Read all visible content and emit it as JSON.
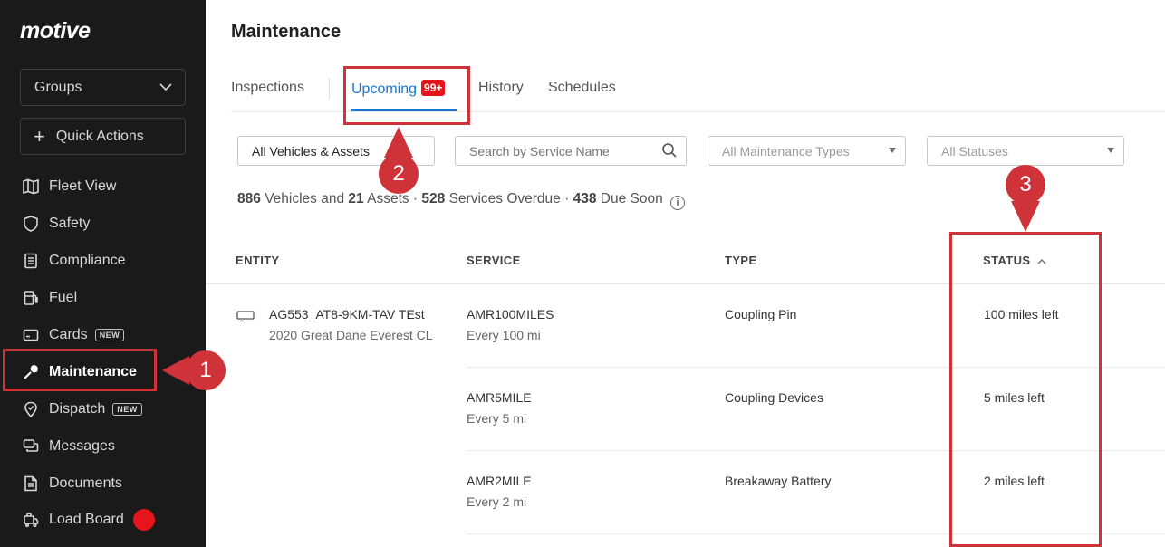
{
  "app": {
    "brand": "motive"
  },
  "sidebar": {
    "groups_label": "Groups",
    "quick_actions_label": "Quick Actions",
    "items": [
      {
        "label": "Fleet View",
        "icon": "map-icon",
        "badge": ""
      },
      {
        "label": "Safety",
        "icon": "shield-icon",
        "badge": ""
      },
      {
        "label": "Compliance",
        "icon": "document-list-icon",
        "badge": ""
      },
      {
        "label": "Fuel",
        "icon": "fuel-pump-icon",
        "badge": ""
      },
      {
        "label": "Cards",
        "icon": "card-icon",
        "badge": "NEW"
      },
      {
        "label": "Maintenance",
        "icon": "wrench-icon",
        "badge": "",
        "active": true
      },
      {
        "label": "Dispatch",
        "icon": "location-pin-icon",
        "badge": "NEW"
      },
      {
        "label": "Messages",
        "icon": "chat-icon",
        "badge": ""
      },
      {
        "label": "Documents",
        "icon": "document-icon",
        "badge": ""
      },
      {
        "label": "Load Board",
        "icon": "truck-lock-icon",
        "badge": ""
      }
    ]
  },
  "page": {
    "title": "Maintenance"
  },
  "tabs": [
    {
      "label": "Inspections"
    },
    {
      "label": "Upcoming",
      "badge": "99+",
      "active": true
    },
    {
      "label": "History"
    },
    {
      "label": "Schedules"
    }
  ],
  "filters": {
    "vehicles": "All Vehicles & Assets",
    "search_placeholder": "Search by Service Name",
    "types": "All Maintenance Types",
    "statuses": "All Statuses"
  },
  "summary": {
    "vehicles_count": "886",
    "vehicles_label": "Vehicles and",
    "assets_count": "21",
    "assets_label": "Assets ·",
    "overdue_count": "528",
    "overdue_label": "Services Overdue ·",
    "due_soon_count": "438",
    "due_soon_label": "Due Soon"
  },
  "table": {
    "columns": {
      "entity": "ENTITY",
      "service": "SERVICE",
      "type": "TYPE",
      "status": "STATUS"
    },
    "entity": {
      "name": "AG553_AT8-9KM-TAV TEst",
      "model": "2020 Great Dane Everest CL"
    },
    "rows": [
      {
        "service": "AMR100MILES",
        "interval": "Every 100 mi",
        "type": "Coupling Pin",
        "status": "100 miles left"
      },
      {
        "service": "AMR5MILE",
        "interval": "Every 5 mi",
        "type": "Coupling Devices",
        "status": "5 miles left"
      },
      {
        "service": "AMR2MILE",
        "interval": "Every 2 mi",
        "type": "Breakaway Battery",
        "status": "2 miles left"
      }
    ]
  },
  "callouts": [
    "1",
    "2",
    "3"
  ],
  "colors": {
    "accent": "#1976d2",
    "callout": "#cf3339",
    "badge": "#e8141b",
    "sidebar_bg": "#1a1a1a"
  }
}
